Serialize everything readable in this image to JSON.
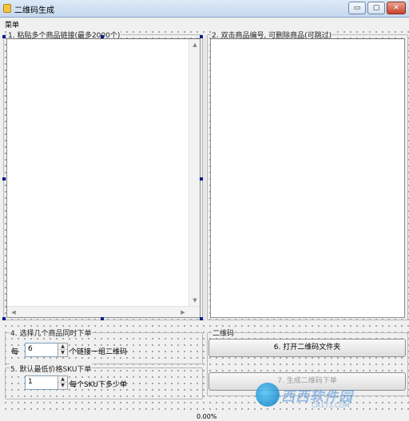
{
  "window": {
    "title": "二维码生成",
    "min_glyph": "▭",
    "max_glyph": "▢",
    "close_glyph": "✕"
  },
  "menu": {
    "label": "菜单"
  },
  "panel1": {
    "title": "1. 粘贴多个商品链接(最多2000个)"
  },
  "panel2": {
    "title": "2. 双击商品编号, 可删除商品(可跳过)"
  },
  "panel4": {
    "title": "4. 选择几个商品同时下单",
    "prefix": "每",
    "value": "6",
    "suffix": "个链接一组二维码"
  },
  "panel5": {
    "title": "5. 默认最低价格SKU下单",
    "value": "1",
    "suffix": "每个SKU下多少单"
  },
  "panel_qr": {
    "title": "二维码",
    "open_folder_label": "6. 打开二维码文件夹",
    "generate_label": "7. 生成二维码下单"
  },
  "status": {
    "progress_text": "0.00%"
  },
  "icons": {
    "scroll_up": "▲",
    "scroll_down": "▼",
    "scroll_left": "◀",
    "scroll_right": "▶",
    "spin_up": "▲",
    "spin_down": "▼"
  },
  "watermark": {
    "brand": "西西软件园",
    "site": "CR173.COM"
  }
}
